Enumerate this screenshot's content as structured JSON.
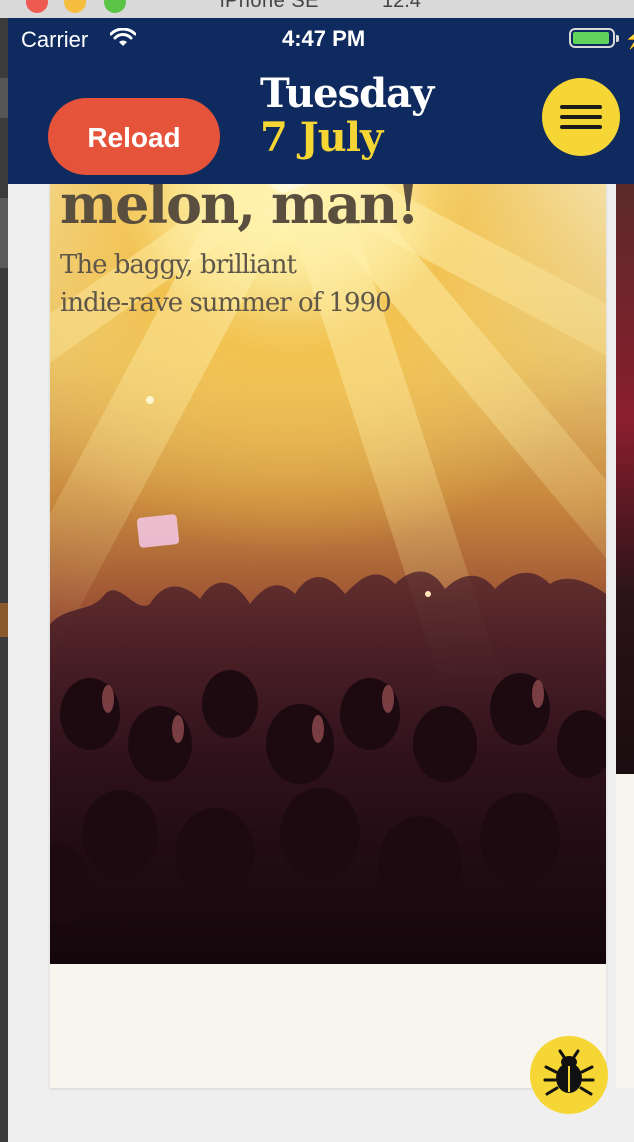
{
  "simulator": {
    "device_name": "iPhone SE",
    "ios_version": "12.4"
  },
  "status_bar": {
    "carrier": "Carrier",
    "time": "4:47 PM"
  },
  "header": {
    "reload_label": "Reload",
    "day": "Tuesday",
    "date": "7 July",
    "menu_icon": "hamburger-menu-icon",
    "accent_color": "#f5d634",
    "background_color": "#0f2a5f",
    "reload_color": "#e5533a"
  },
  "card": {
    "headline": "melon, man!",
    "subhead_line1": "The baggy, brilliant",
    "subhead_line2": "indie-rave summer of 1990"
  },
  "debug_button": {
    "icon": "bug-icon"
  }
}
